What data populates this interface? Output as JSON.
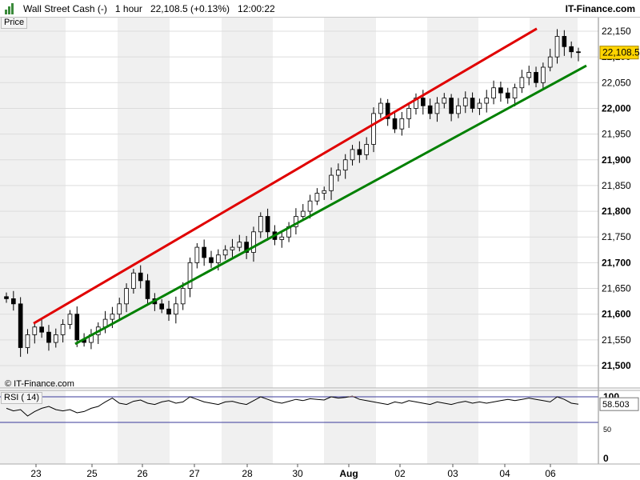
{
  "header": {
    "title": "Wall Street Cash (-)",
    "interval": "1 hour",
    "price_change": "22,108.5 (+0.13%)",
    "time": "12:00:22",
    "brand": "IT-Finance.com"
  },
  "panel_labels": {
    "price": "Price",
    "rsi": "RSI ( 14)",
    "copyright": "© IT-Finance.com"
  },
  "colors": {
    "upper_channel": "#e00000",
    "lower_channel": "#008000",
    "candle_up": "#ffffff",
    "candle_down": "#000000",
    "price_tag": "#ffd400",
    "rsi_line": "#000000",
    "rsi_bands": "#3a3a9a",
    "rsi_fill": "#c090a0"
  },
  "chart_data": [
    {
      "type": "candlestick",
      "x_tick_labels": [
        "23",
        "25",
        "26",
        "27",
        "28",
        "30",
        "Aug",
        "02",
        "03",
        "04",
        "06"
      ],
      "y_ticks": [
        21500,
        21550,
        21600,
        21650,
        21700,
        21750,
        21800,
        21850,
        21900,
        21950,
        22000,
        22050,
        22100,
        22150
      ],
      "y_tick_labels": [
        "21,500",
        "21,550",
        "21,600",
        "21,650",
        "21,700",
        "21,750",
        "21,800",
        "21,850",
        "21,900",
        "21,950",
        "22,000",
        "22,050",
        "22,100",
        "22,150"
      ],
      "ylim": [
        21480,
        22170
      ],
      "last_price": 22108.5,
      "last_price_label": "22,108.5",
      "closes": [
        21630,
        21620,
        21535,
        21560,
        21575,
        21565,
        21545,
        21560,
        21580,
        21600,
        21550,
        21545,
        21560,
        21575,
        21590,
        21600,
        21620,
        21650,
        21680,
        21665,
        21630,
        21620,
        21610,
        21600,
        21620,
        21650,
        21700,
        21730,
        21710,
        21700,
        21715,
        21725,
        21730,
        21740,
        21720,
        21760,
        21790,
        21760,
        21745,
        21750,
        21770,
        21790,
        21800,
        21820,
        21835,
        21840,
        21870,
        21880,
        21900,
        21920,
        21910,
        21930,
        21990,
        22010,
        21980,
        21960,
        21980,
        22000,
        22020,
        22005,
        21990,
        22010,
        22020,
        21990,
        22005,
        22020,
        22000,
        22010,
        22020,
        22040,
        22030,
        22020,
        22040,
        22060,
        22070,
        22050,
        22080,
        22100,
        22140,
        22120,
        22110,
        22108.5
      ],
      "upper_channel": {
        "start": 21582,
        "end": 22155
      },
      "lower_channel": {
        "start": 21542,
        "end": 22083
      }
    },
    {
      "type": "line",
      "series": [
        {
          "name": "RSI ( 14)"
        }
      ],
      "y_tick_labels": [
        "100",
        "50",
        "0"
      ],
      "ylim": [
        0,
        100
      ],
      "bands": [
        70,
        30
      ],
      "last_value": 58.503,
      "last_value_label": "58.503",
      "values": [
        52,
        48,
        50,
        40,
        47,
        52,
        55,
        50,
        48,
        50,
        45,
        47,
        52,
        55,
        62,
        68,
        60,
        58,
        63,
        65,
        60,
        58,
        62,
        64,
        60,
        62,
        70,
        66,
        62,
        60,
        58,
        62,
        63,
        60,
        58,
        64,
        70,
        66,
        62,
        60,
        63,
        66,
        64,
        67,
        66,
        65,
        70,
        68,
        69,
        71,
        66,
        64,
        62,
        60,
        58,
        62,
        60,
        64,
        62,
        60,
        58,
        62,
        60,
        58,
        61,
        63,
        60,
        62,
        60,
        62,
        64,
        66,
        64,
        66,
        68,
        66,
        64,
        62,
        70,
        66,
        60,
        58.5
      ]
    }
  ]
}
